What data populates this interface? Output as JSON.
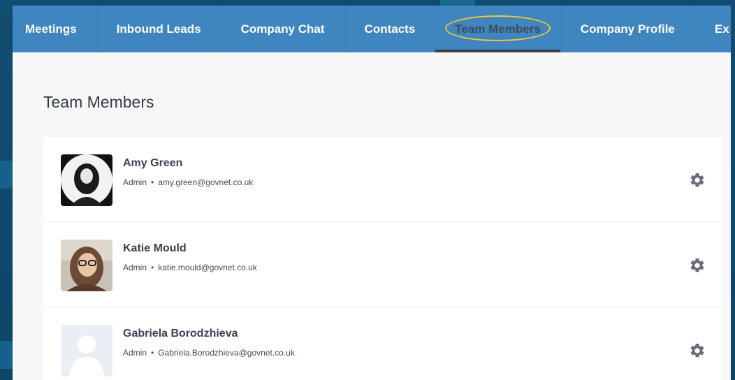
{
  "nav": {
    "items": [
      {
        "label": "Meetings"
      },
      {
        "label": "Inbound Leads"
      },
      {
        "label": "Company Chat"
      },
      {
        "label": "Contacts"
      },
      {
        "label": "Team Members"
      },
      {
        "label": "Company Profile"
      },
      {
        "label": "Ex"
      }
    ],
    "active_index": 4
  },
  "page": {
    "title": "Team Members"
  },
  "members": [
    {
      "name": "Amy Green",
      "role": "Admin",
      "email": "amy.green@govnet.co.uk",
      "avatar": "photo-dark"
    },
    {
      "name": "Katie Mould",
      "role": "Admin",
      "email": "katie.mould@govnet.co.uk",
      "avatar": "photo-color"
    },
    {
      "name": "Gabriela Borodzhieva",
      "role": "Admin",
      "email": "Gabriela.Borodzhieva@govnet.co.uk",
      "avatar": "placeholder"
    }
  ],
  "icons": {
    "settings": "gear-icon",
    "separator": "•"
  },
  "colors": {
    "navbar": "#3f86c1",
    "highlight": "#f2c43a",
    "background": "#0f4f72",
    "content": "#f7f7f8"
  }
}
